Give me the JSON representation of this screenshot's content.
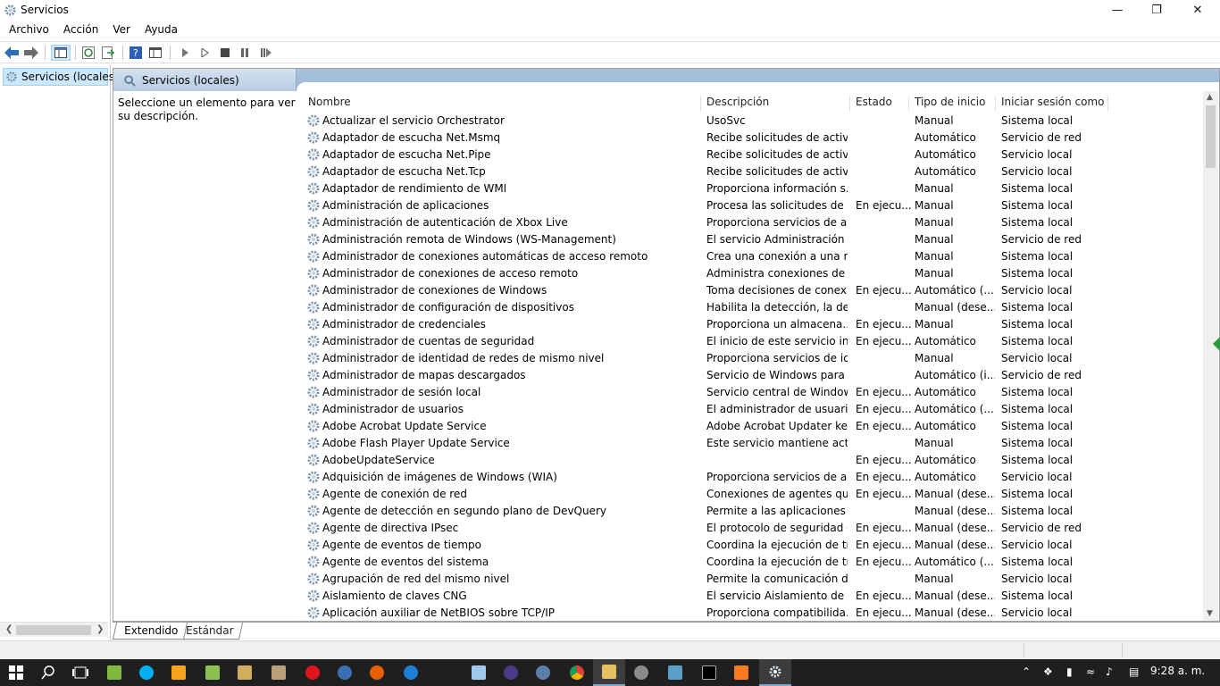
{
  "window": {
    "title": "Servicios",
    "min_icon": "minimize-icon",
    "max_icon": "restore-icon",
    "close_icon": "close-icon"
  },
  "menu": [
    "Archivo",
    "Acción",
    "Ver",
    "Ayuda"
  ],
  "toolbar_icons": [
    "back-icon",
    "forward-icon",
    "show-hide-tree-icon",
    "refresh-icon",
    "export-list-icon",
    "help-icon",
    "properties-icon",
    "start-service-icon",
    "start-service-alt-icon",
    "stop-service-icon",
    "pause-service-icon",
    "restart-service-icon"
  ],
  "tree": {
    "item": "Servicios (locales)"
  },
  "panel": {
    "title": "Servicios (locales)",
    "description_prompt": "Seleccione un elemento para ver su descripción."
  },
  "columns": {
    "name": "Nombre",
    "description": "Descripción",
    "state": "Estado",
    "startup": "Tipo de inicio",
    "logon": "Iniciar sesión como"
  },
  "services": [
    {
      "name": "Actualizar el servicio Orchestrator",
      "desc": "UsoSvc",
      "state": "",
      "start": "Manual",
      "logon": "Sistema local"
    },
    {
      "name": "Adaptador de escucha Net.Msmq",
      "desc": "Recibe solicitudes de activa...",
      "state": "",
      "start": "Automático",
      "logon": "Servicio de red"
    },
    {
      "name": "Adaptador de escucha Net.Pipe",
      "desc": "Recibe solicitudes de activa...",
      "state": "",
      "start": "Automático",
      "logon": "Servicio local"
    },
    {
      "name": "Adaptador de escucha Net.Tcp",
      "desc": "Recibe solicitudes de activa...",
      "state": "",
      "start": "Automático",
      "logon": "Servicio local"
    },
    {
      "name": "Adaptador de rendimiento de WMI",
      "desc": "Proporciona información s...",
      "state": "",
      "start": "Manual",
      "logon": "Sistema local"
    },
    {
      "name": "Administración de aplicaciones",
      "desc": "Procesa las solicitudes de in...",
      "state": "En ejecu...",
      "start": "Manual",
      "logon": "Sistema local"
    },
    {
      "name": "Administración de autenticación de Xbox Live",
      "desc": "Proporciona servicios de au...",
      "state": "",
      "start": "Manual",
      "logon": "Sistema local"
    },
    {
      "name": "Administración remota de Windows (WS-Management)",
      "desc": "El servicio Administración r...",
      "state": "",
      "start": "Manual",
      "logon": "Servicio de red"
    },
    {
      "name": "Administrador de conexiones automáticas de acceso remoto",
      "desc": "Crea una conexión a una re...",
      "state": "",
      "start": "Manual",
      "logon": "Sistema local"
    },
    {
      "name": "Administrador de conexiones de acceso remoto",
      "desc": "Administra conexiones de a...",
      "state": "",
      "start": "Manual",
      "logon": "Sistema local"
    },
    {
      "name": "Administrador de conexiones de Windows",
      "desc": "Toma decisiones de conexi...",
      "state": "En ejecu...",
      "start": "Automático (...",
      "logon": "Servicio local"
    },
    {
      "name": "Administrador de configuración de dispositivos",
      "desc": "Habilita la detección, la des...",
      "state": "",
      "start": "Manual (dese...",
      "logon": "Sistema local"
    },
    {
      "name": "Administrador de credenciales",
      "desc": "Proporciona un almacena...",
      "state": "En ejecu...",
      "start": "Manual",
      "logon": "Sistema local"
    },
    {
      "name": "Administrador de cuentas de seguridad",
      "desc": "El inicio de este servicio ind...",
      "state": "En ejecu...",
      "start": "Automático",
      "logon": "Sistema local"
    },
    {
      "name": "Administrador de identidad de redes de mismo nivel",
      "desc": "Proporciona servicios de id...",
      "state": "",
      "start": "Manual",
      "logon": "Servicio local"
    },
    {
      "name": "Administrador de mapas descargados",
      "desc": "Servicio de Windows para e...",
      "state": "",
      "start": "Automático (i...",
      "logon": "Servicio de red"
    },
    {
      "name": "Administrador de sesión local",
      "desc": "Servicio central de Window...",
      "state": "En ejecu...",
      "start": "Automático",
      "logon": "Sistema local"
    },
    {
      "name": "Administrador de usuarios",
      "desc": "El administrador de usuario...",
      "state": "En ejecu...",
      "start": "Automático (...",
      "logon": "Sistema local"
    },
    {
      "name": "Adobe Acrobat Update Service",
      "desc": "Adobe Acrobat Updater kee...",
      "state": "En ejecu...",
      "start": "Automático",
      "logon": "Sistema local"
    },
    {
      "name": "Adobe Flash Player Update Service",
      "desc": "Este servicio mantiene actu...",
      "state": "",
      "start": "Manual",
      "logon": "Sistema local"
    },
    {
      "name": "AdobeUpdateService",
      "desc": "",
      "state": "En ejecu...",
      "start": "Automático",
      "logon": "Sistema local"
    },
    {
      "name": "Adquisición de imágenes de Windows (WIA)",
      "desc": "Proporciona servicios de ad...",
      "state": "En ejecu...",
      "start": "Automático",
      "logon": "Servicio local"
    },
    {
      "name": "Agente de conexión de red",
      "desc": "Conexiones de agentes que...",
      "state": "En ejecu...",
      "start": "Manual (dese...",
      "logon": "Sistema local"
    },
    {
      "name": "Agente de detección en segundo plano de DevQuery",
      "desc": "Permite a las aplicaciones d...",
      "state": "",
      "start": "Manual (dese...",
      "logon": "Sistema local"
    },
    {
      "name": "Agente de directiva IPsec",
      "desc": "El protocolo de seguridad d...",
      "state": "En ejecu...",
      "start": "Manual (dese...",
      "logon": "Servicio de red"
    },
    {
      "name": "Agente de eventos de tiempo",
      "desc": "Coordina la ejecución de tr...",
      "state": "En ejecu...",
      "start": "Manual (dese...",
      "logon": "Servicio local"
    },
    {
      "name": "Agente de eventos del sistema",
      "desc": "Coordina la ejecución de tr...",
      "state": "En ejecu...",
      "start": "Automático (...",
      "logon": "Sistema local"
    },
    {
      "name": "Agrupación de red del mismo nivel",
      "desc": "Permite la comunicación d...",
      "state": "",
      "start": "Manual",
      "logon": "Servicio local"
    },
    {
      "name": "Aislamiento de claves CNG",
      "desc": "El servicio Aislamiento de cl...",
      "state": "En ejecu...",
      "start": "Manual (dese...",
      "logon": "Sistema local"
    },
    {
      "name": "Aplicación auxiliar de NetBIOS sobre TCP/IP",
      "desc": "Proporciona compatibilida...",
      "state": "En ejecu...",
      "start": "Manual (dese...",
      "logon": "Servicio local"
    }
  ],
  "bottom_tabs": [
    "Extendido",
    "Estándar"
  ],
  "taskbar": {
    "icons": [
      "start-icon",
      "search-icon",
      "task-view-icon",
      "file-manager-icon",
      "skype-icon",
      "media-player-icon",
      "android-icon",
      "calculator-icon",
      "notepad-icon",
      "opera-icon",
      "globe-icon",
      "firefox-icon",
      "edge-icon",
      "notes-icon",
      "eclipse-icon",
      "vpn-icon",
      "chrome-icon",
      "file-explorer-icon",
      "app-icon",
      "app2-icon",
      "cmd-icon",
      "xampp-icon",
      "services-icon"
    ],
    "tray_icons": [
      "chevron-up-icon",
      "dropbox-icon",
      "battery-icon",
      "network-icon",
      "volume-icon",
      "notification-icon"
    ],
    "clock": "9:28 a. m."
  }
}
